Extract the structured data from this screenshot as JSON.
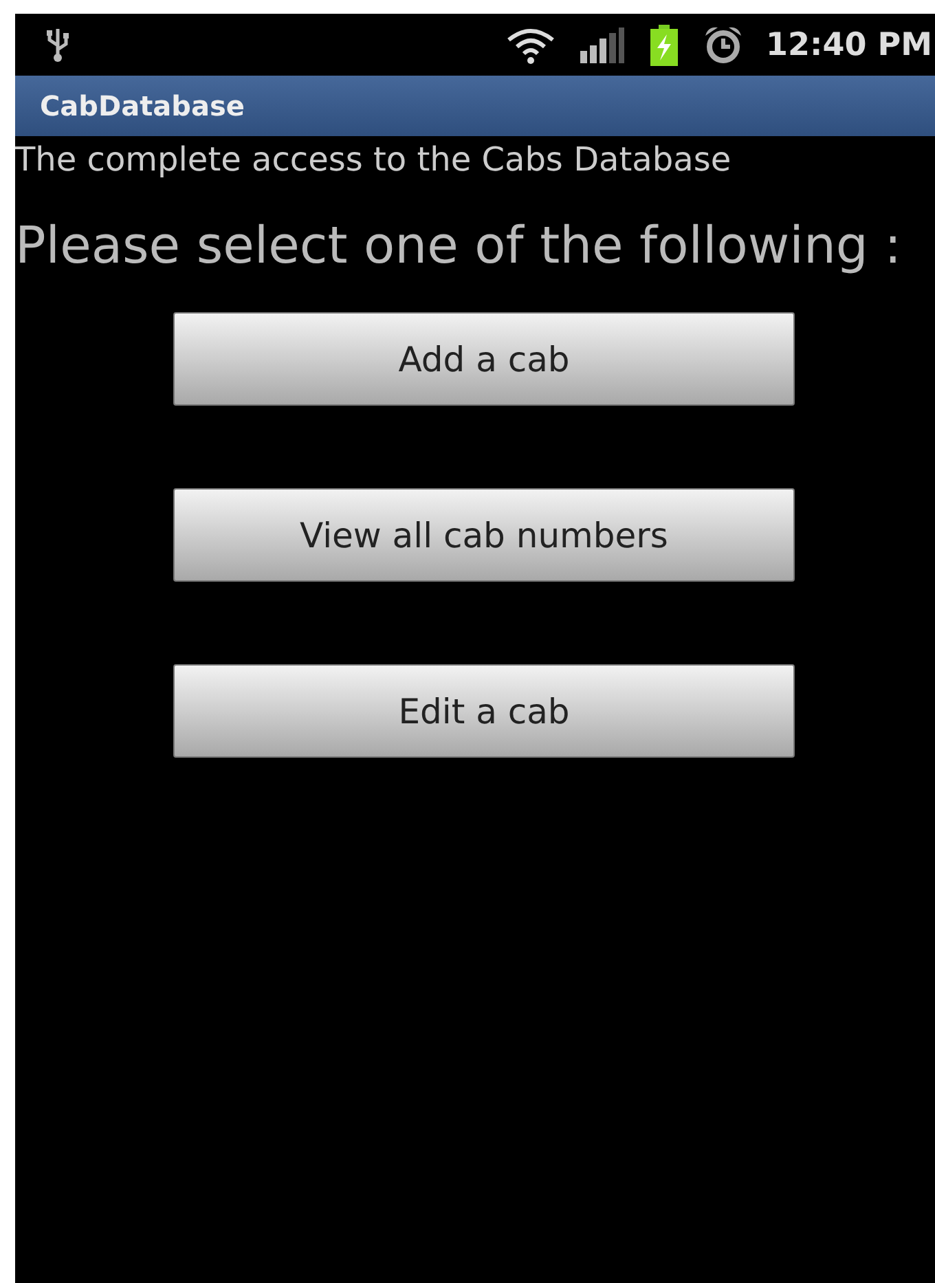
{
  "status_bar": {
    "time": "12:40 PM"
  },
  "title_bar": {
    "title": "CabDatabase"
  },
  "subtitle": "The complete access to the Cabs Database",
  "prompt": "Please select one of the following :",
  "buttons": [
    "Add a cab",
    "View all cab numbers",
    "Edit a cab"
  ]
}
